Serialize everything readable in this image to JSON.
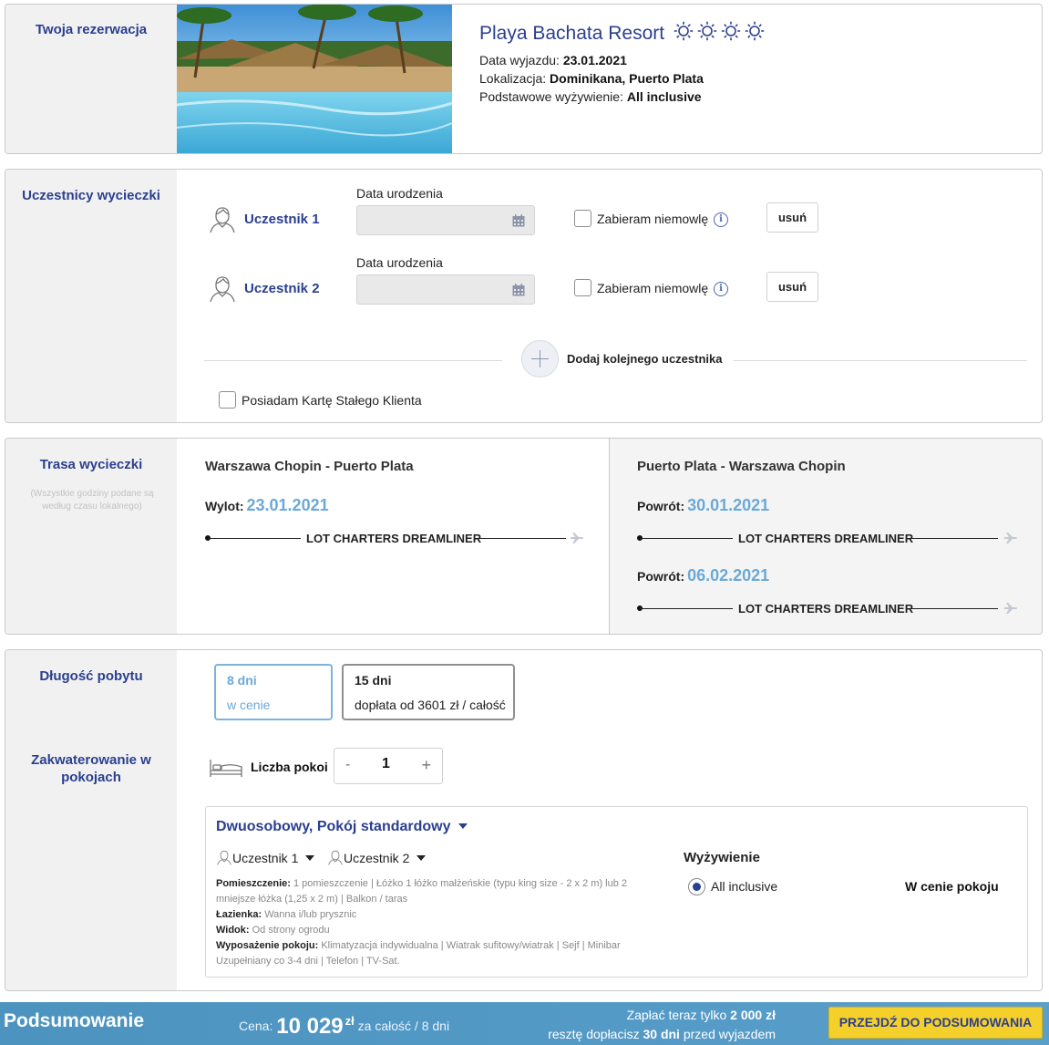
{
  "reservation": {
    "section_title": "Twoja rezerwacja",
    "hotel_name": "Playa Bachata Resort",
    "stars": 4,
    "departure_label": "Data wyjazdu:",
    "departure_value": "23.01.2021",
    "location_label": "Lokalizacja:",
    "location_value": "Dominikana, Puerto Plata",
    "board_label": "Podstawowe wyżywienie:",
    "board_value": "All inclusive"
  },
  "participants": {
    "section_title": "Uczestnicy wycieczki",
    "items": [
      {
        "name": "Uczestnik 1",
        "date_label": "Data urodzenia",
        "date_value": "",
        "infant_label": "Zabieram niemowlę",
        "remove_label": "usuń"
      },
      {
        "name": "Uczestnik 2",
        "date_label": "Data urodzenia",
        "date_value": "",
        "infant_label": "Zabieram niemowlę",
        "remove_label": "usuń"
      }
    ],
    "add_label": "Dodaj kolejnego uczestnika",
    "loyalty_label": "Posiadam Kartę Stałego Klienta",
    "icons": [
      "person-icon",
      "calendar-icon",
      "info-icon",
      "plus-icon"
    ]
  },
  "route": {
    "section_title": "Trasa wycieczki",
    "note": "(Wszystkie godziny podane są według czasu lokalnego)",
    "outbound": {
      "title": "Warszawa Chopin - Puerto Plata",
      "flights": [
        {
          "label": "Wylot:",
          "date": "23.01.2021",
          "carrier": "LOT CHARTERS DREAMLINER"
        }
      ]
    },
    "return": {
      "title": "Puerto Plata - Warszawa Chopin",
      "flights": [
        {
          "label": "Powrót:",
          "date": "30.01.2021",
          "carrier": "LOT CHARTERS DREAMLINER"
        },
        {
          "label": "Powrót:",
          "date": "06.02.2021",
          "carrier": "LOT CHARTERS DREAMLINER"
        }
      ]
    }
  },
  "stay": {
    "section_title": "Długość pobytu",
    "options": [
      {
        "days": "8 dni",
        "price_text": "w cenie",
        "selected": true
      },
      {
        "days": "15 dni",
        "price_text": "dopłata od 3601 zł / całość",
        "selected": false
      }
    ]
  },
  "accommodation": {
    "section_title": "Zakwaterowanie w pokojach",
    "rooms_label": "Liczba pokoi",
    "rooms_count": "1",
    "minus": "-",
    "plus": "+",
    "room_type": "Dwuosobowy, Pokój standardowy",
    "occupants": [
      "Uczestnik 1",
      "Uczestnik 2"
    ],
    "details": {
      "room_label": "Pomieszczenie:",
      "room_value_1": "1 pomieszczenie",
      "room_value_2": "Łóżko 1 łóżko małżeńskie (typu king size - 2 x 2 m) lub 2 mniejsze łóżka (1,25 x 2 m)",
      "room_value_3": "Balkon / taras",
      "bath_label": "Łazienka:",
      "bath_value": "Wanna i/lub prysznic",
      "view_label": "Widok:",
      "view_value": "Od strony ogrodu",
      "equip_label": "Wyposażenie pokoju:",
      "equip_1": "Klimatyzacja indywidualna",
      "equip_2": "Wiatrak sufitowy/wiatrak",
      "equip_3": "Sejf",
      "equip_4": "Minibar",
      "equip_5": "Uzupełniany co 3-4 dni",
      "equip_6": "Telefon",
      "equip_7": "TV-Sat."
    },
    "meals_title": "Wyżywienie",
    "meal_option": "All inclusive",
    "meal_price": "W cenie pokoju"
  },
  "summary": {
    "title": "Podsumowanie",
    "price_label": "Cena:",
    "price_value": "10 029",
    "currency": "zł",
    "price_suffix": "za całość / 8 dni",
    "pay_now_prefix": "Zapłać teraz tylko",
    "pay_now_amount": "2 000 zł",
    "remaining_prefix": "resztę dopłacisz",
    "remaining_days": "30 dni",
    "remaining_suffix": "przed wyjazdem",
    "button_label": "PRZEJDŹ DO PODSUMOWANIA"
  },
  "colors": {
    "brand_blue": "#2b3f8f",
    "accent_light_blue": "#6aa9d8",
    "footer_bg": "#4c93bf",
    "cta_yellow": "#f5d02b"
  }
}
